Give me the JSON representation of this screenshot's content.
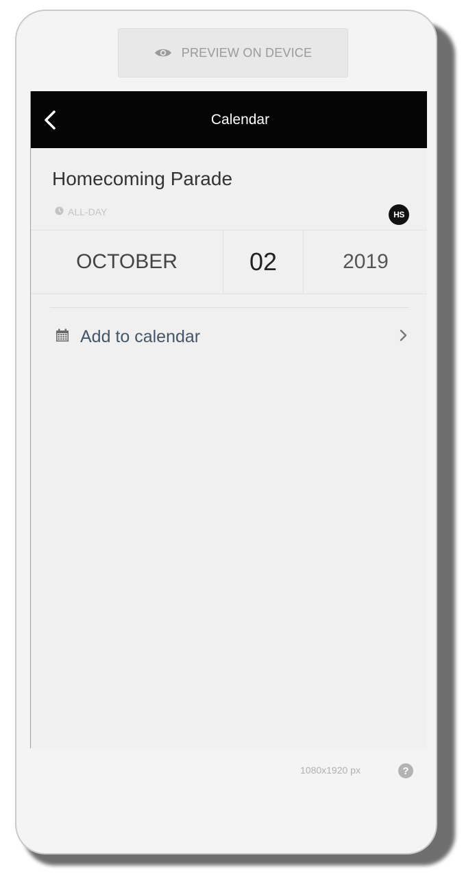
{
  "preview_button": {
    "label": "PREVIEW ON DEVICE",
    "icon": "eye-icon"
  },
  "navbar": {
    "title": "Calendar",
    "back_icon": "back-chevron-icon"
  },
  "event": {
    "title": "Homecoming Parade",
    "time_label": "ALL-DAY",
    "badge": "HS"
  },
  "date": {
    "month": "OCTOBER",
    "day": "02",
    "year": "2019"
  },
  "actions": {
    "add_to_calendar": "Add to calendar"
  },
  "footer": {
    "resolution": "1080x1920 px",
    "help_icon": "?"
  },
  "colors": {
    "navbar_bg": "#050505",
    "screen_bg": "#f0f0f0",
    "link_text": "#445566"
  }
}
